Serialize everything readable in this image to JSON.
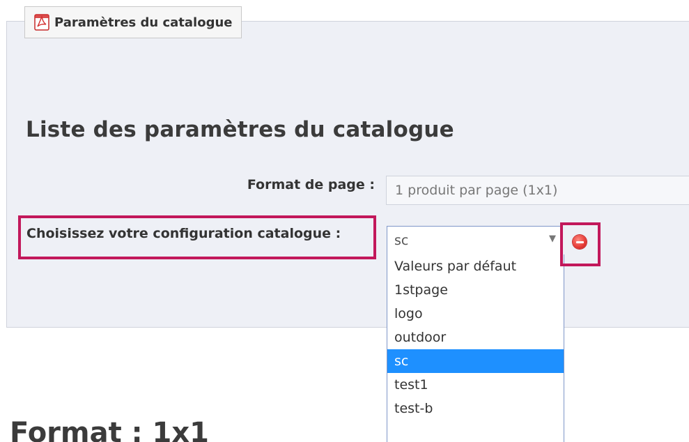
{
  "panel": {
    "legend_label": "Paramètres du catalogue",
    "legend_icon": "pdf-icon"
  },
  "section_title": "Liste des paramètres du catalogue",
  "format_field": {
    "label": "Format de page :",
    "value": "1 produit par page (1x1)"
  },
  "config_field": {
    "label": "Choisissez votre configuration catalogue :",
    "selected": "sc",
    "options": [
      "Valeurs par défaut",
      "1stpage",
      "logo",
      "outdoor",
      "sc",
      "test1",
      "test-b"
    ],
    "highlight_index": 4
  },
  "remove_button": {
    "icon": "minus-circle-icon",
    "color": "#e53935"
  },
  "highlight_color": "#c2185b",
  "format_heading": "Format : 1x1"
}
